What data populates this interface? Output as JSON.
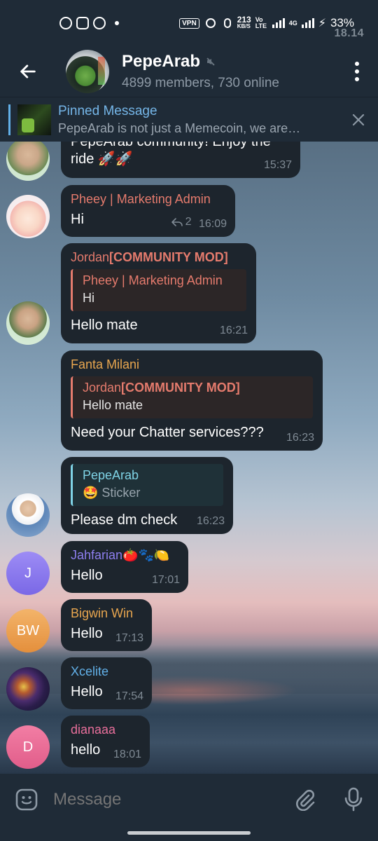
{
  "status_bar": {
    "time": "18.14",
    "vpn": "VPN",
    "speed_value": "213",
    "speed_unit": "KB/S",
    "volte": "Vo LTE",
    "network": "4G",
    "battery": "33%"
  },
  "header": {
    "title": "PepeArab",
    "subtitle": "4899 members, 730 online"
  },
  "pinned": {
    "title": "Pinned Message",
    "body": "PepeArab is not just a Memecoin, we are…"
  },
  "messages": [
    {
      "text": "PepeArab community! Enjoy the ride 🚀🚀",
      "time": "15:37"
    },
    {
      "sender": "Pheey | Marketing Admin",
      "text": "Hi",
      "replies": "2",
      "time": "16:09"
    },
    {
      "sender": "Jordan",
      "sender_tag": "[COMMUNITY MOD]",
      "reply_name": "Pheey | Marketing Admin",
      "reply_text": "Hi",
      "text": "Hello mate",
      "time": "16:21"
    },
    {
      "sender": "Fanta Milani",
      "reply_name": "Jordan",
      "reply_tag": "[COMMUNITY MOD]",
      "reply_text": "Hello mate",
      "text": "Need your Chatter services???",
      "time": "16:23"
    },
    {
      "reply_name": "PepeArab",
      "reply_text": "🤩 Sticker",
      "text": "Please dm check",
      "time": "16:23"
    },
    {
      "sender": "Jahfarian🍅🐾🍋",
      "text": "Hello",
      "time": "17:01",
      "avatar_letter": "J"
    },
    {
      "sender": "Bigwin Win",
      "text": "Hello",
      "time": "17:13",
      "avatar_letter": "BW"
    },
    {
      "sender": "Xcelite",
      "text": "Hello",
      "time": "17:54"
    },
    {
      "sender": "dianaaa",
      "text": "hello",
      "time": "18:01",
      "avatar_letter": "D"
    }
  ],
  "input": {
    "placeholder": "Message"
  },
  "colors": {
    "bar_bg": "#1f2b37",
    "bubble_bg": "#1d252d",
    "pheey": "#e57b6d",
    "jordan": "#e57b6d",
    "fanta": "#e8a64f",
    "jahfarian": "#8e7ff0",
    "bigwin": "#e8a64f",
    "xcelite": "#62b0e8",
    "dianaaa": "#e86f9b",
    "pepearab_reply": "#7fd3e6"
  },
  "icons": [
    "back-arrow-icon",
    "mute-icon",
    "more-vert-icon",
    "close-icon",
    "reply-icon",
    "emoji-icon",
    "attach-icon",
    "mic-icon"
  ]
}
